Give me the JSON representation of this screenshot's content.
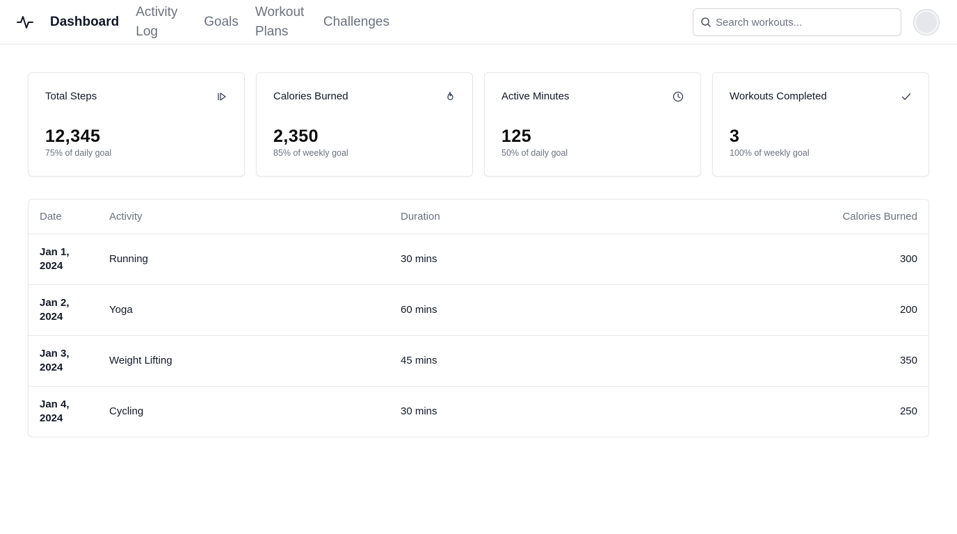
{
  "nav": {
    "items": [
      {
        "label": "Dashboard",
        "active": true
      },
      {
        "label": "Activity Log",
        "active": false
      },
      {
        "label": "Goals",
        "active": false
      },
      {
        "label": "Workout Plans",
        "active": false
      },
      {
        "label": "Challenges",
        "active": false
      }
    ]
  },
  "search": {
    "placeholder": "Search workouts...",
    "value": ""
  },
  "cards": [
    {
      "title": "Total Steps",
      "value": "12,345",
      "sub": "75% of daily goal",
      "icon": "steps-icon"
    },
    {
      "title": "Calories Burned",
      "value": "2,350",
      "sub": "85% of weekly goal",
      "icon": "flame-icon"
    },
    {
      "title": "Active Minutes",
      "value": "125",
      "sub": "50% of daily goal",
      "icon": "clock-icon"
    },
    {
      "title": "Workouts Completed",
      "value": "3",
      "sub": "100% of weekly goal",
      "icon": "check-icon"
    }
  ],
  "table": {
    "headers": [
      "Date",
      "Activity",
      "Duration",
      "Calories Burned"
    ],
    "rows": [
      {
        "date": "Jan 1, 2024",
        "activity": "Running",
        "duration": "30 mins",
        "calories": "300"
      },
      {
        "date": "Jan 2, 2024",
        "activity": "Yoga",
        "duration": "60 mins",
        "calories": "200"
      },
      {
        "date": "Jan 3, 2024",
        "activity": "Weight Lifting",
        "duration": "45 mins",
        "calories": "350"
      },
      {
        "date": "Jan 4, 2024",
        "activity": "Cycling",
        "duration": "30 mins",
        "calories": "250"
      }
    ]
  }
}
